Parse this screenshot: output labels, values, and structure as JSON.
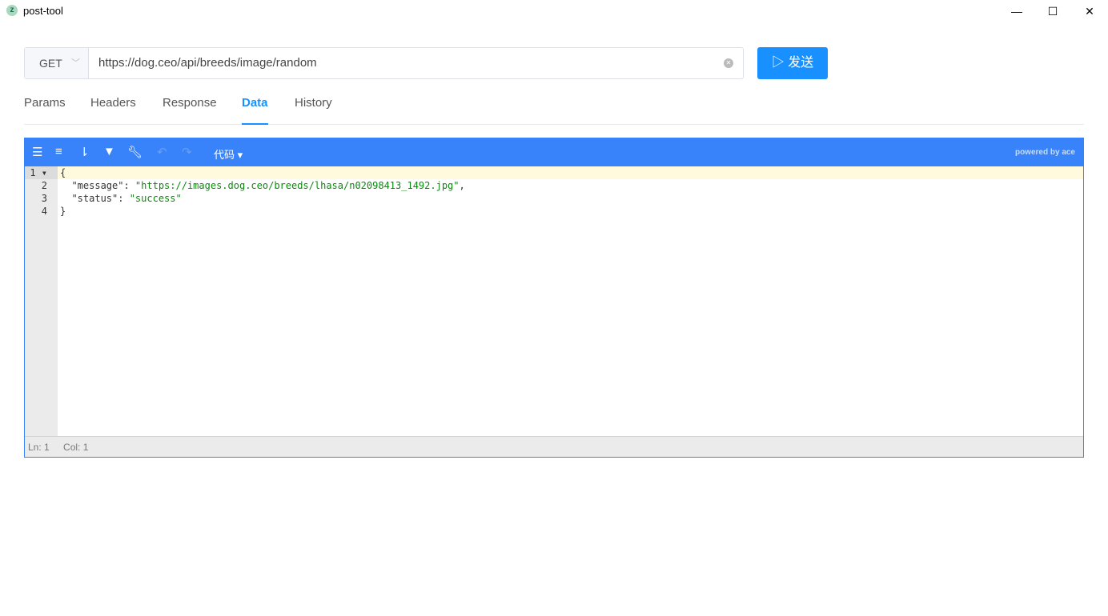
{
  "window": {
    "title": "post-tool",
    "logo_letter": "z",
    "minimize": "—",
    "maximize": "☐",
    "close": "✕"
  },
  "request": {
    "method": "GET",
    "url": "https://dog.ceo/api/breeds/image/random",
    "send_label": "发送"
  },
  "tabs": [
    {
      "label": "Params"
    },
    {
      "label": "Headers"
    },
    {
      "label": "Response"
    },
    {
      "label": "Data",
      "active": true
    },
    {
      "label": "History"
    }
  ],
  "editor": {
    "mode_label": "代码",
    "powered_by": "powered by ace",
    "line_numbers": [
      "1",
      "2",
      "3",
      "4"
    ],
    "lines": {
      "l1": "{",
      "l2_key": "  \"message\": ",
      "l2_val": "\"https://images.dog.ceo/breeds/lhasa/n02098413_1492.jpg\"",
      "l2_end": ",",
      "l3_key": "  \"status\": ",
      "l3_val": "\"success\"",
      "l4": "}"
    },
    "status": {
      "ln": "Ln: 1",
      "col": "Col: 1"
    }
  },
  "colors": {
    "accent": "#1890ff",
    "editor_bar": "#3883fa",
    "string": "#0a8a0a"
  }
}
